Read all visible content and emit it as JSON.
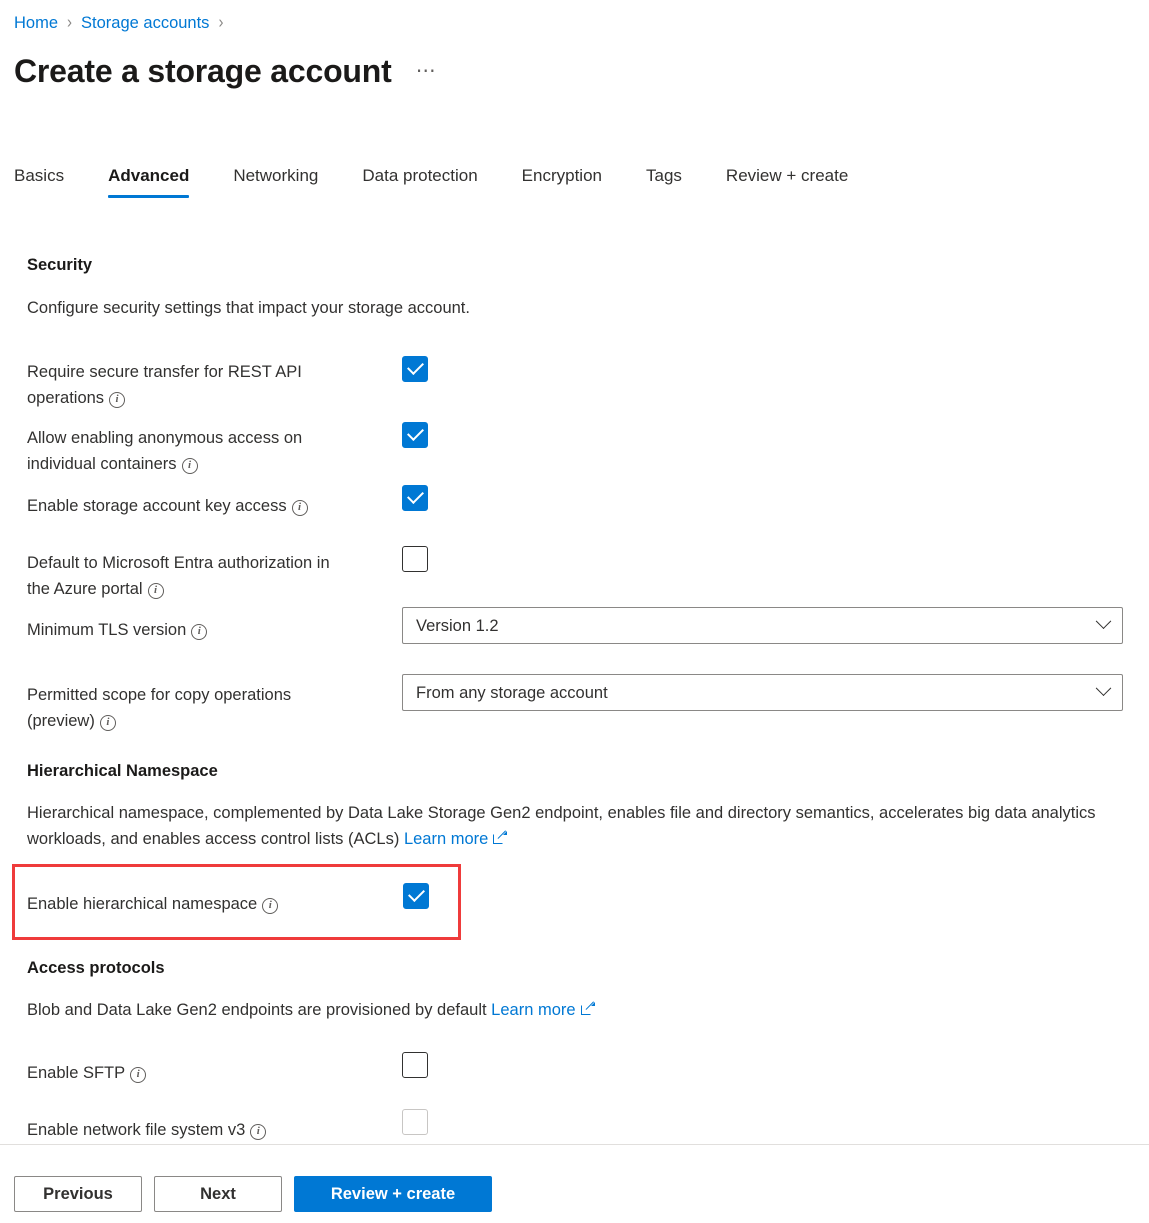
{
  "breadcrumb": {
    "items": [
      "Home",
      "Storage accounts"
    ],
    "separator": "›"
  },
  "header": {
    "title": "Create a storage account",
    "more_menu": "⋯"
  },
  "tabs": [
    {
      "label": "Basics",
      "active": false
    },
    {
      "label": "Advanced",
      "active": true
    },
    {
      "label": "Networking",
      "active": false
    },
    {
      "label": "Data protection",
      "active": false
    },
    {
      "label": "Encryption",
      "active": false
    },
    {
      "label": "Tags",
      "active": false
    },
    {
      "label": "Review + create",
      "active": false
    }
  ],
  "security": {
    "heading": "Security",
    "description": "Configure security settings that impact your storage account.",
    "fields": {
      "secure_transfer": {
        "label_line1": "Require secure transfer for REST API",
        "label_line2": "operations",
        "checked": true
      },
      "anonymous_access": {
        "label_line1": "Allow enabling anonymous access on",
        "label_line2": "individual containers",
        "checked": true
      },
      "key_access": {
        "label": "Enable storage account key access",
        "checked": true
      },
      "entra_default": {
        "label_line1": "Default to Microsoft Entra authorization in",
        "label_line2": "the Azure portal",
        "checked": false
      },
      "min_tls": {
        "label": "Minimum TLS version",
        "value": "Version 1.2"
      },
      "copy_scope": {
        "label_line1": "Permitted scope for copy operations",
        "label_line2": "(preview)",
        "value": "From any storage account"
      }
    }
  },
  "hierarchical_namespace": {
    "heading": "Hierarchical Namespace",
    "description_line1": "Hierarchical namespace, complemented by Data Lake Storage Gen2 endpoint, enables file and directory semantics, accelerates",
    "description_line2": "big data analytics workloads, and enables access control lists (ACLs)",
    "learn_more": "Learn more",
    "enable": {
      "label": "Enable hierarchical namespace",
      "checked": true,
      "highlighted": true
    },
    "highlight_color": "#ef3b3b"
  },
  "access_protocols": {
    "heading": "Access protocols",
    "description": "Blob and Data Lake Gen2 endpoints are provisioned by default",
    "learn_more": "Learn more",
    "sftp": {
      "label": "Enable SFTP",
      "checked": false,
      "disabled": false
    },
    "nfs": {
      "label": "Enable network file system v3",
      "checked": false,
      "disabled": true
    }
  },
  "footer": {
    "previous": "Previous",
    "next": "Next",
    "review_create": "Review + create"
  },
  "colors": {
    "accent": "#0078d4",
    "link": "#0078d4",
    "text": "#323130",
    "highlight": "#ef3b3b",
    "border": "#8a8886"
  }
}
